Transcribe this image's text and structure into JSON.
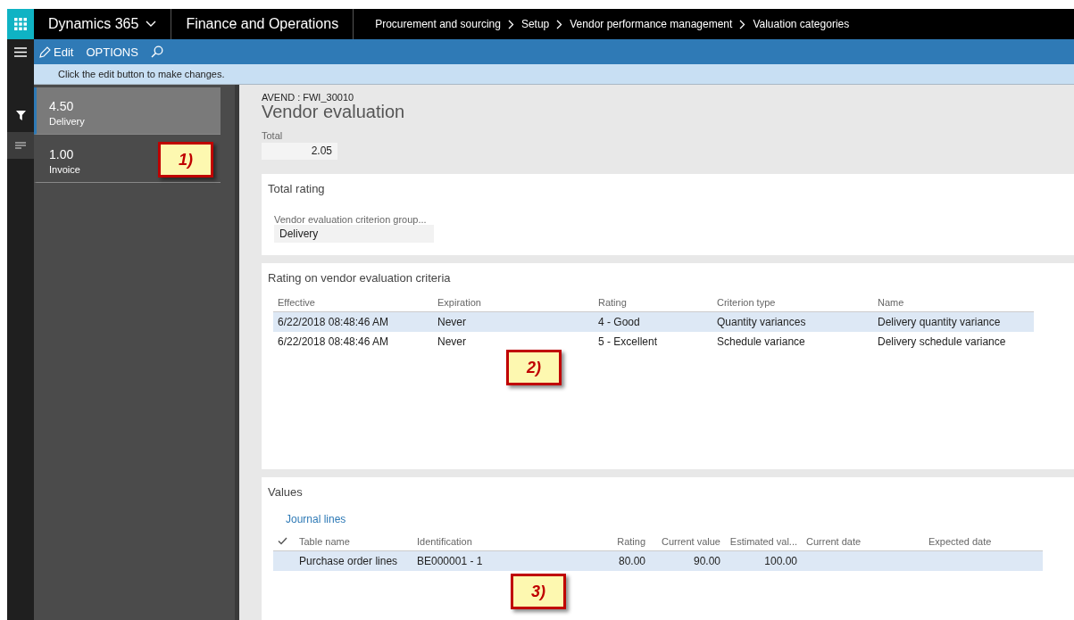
{
  "top_bar": {
    "product": "Dynamics 365",
    "app": "Finance and Operations",
    "breadcrumb": [
      "Procurement and sourcing",
      "Setup",
      "Vendor performance management",
      "Valuation categories"
    ]
  },
  "action_bar": {
    "edit": "Edit",
    "options": "OPTIONS"
  },
  "message": "Click the edit button to make changes.",
  "side_rail": [
    {
      "kind": "filter",
      "selected": false
    },
    {
      "kind": "list",
      "selected": true
    }
  ],
  "list": [
    {
      "value": "4.50",
      "label": "Delivery",
      "selected": true
    },
    {
      "value": "1.00",
      "label": "Invoice",
      "selected": false
    }
  ],
  "header": {
    "caption": "AVEND : FWI_30010",
    "title": "Vendor evaluation",
    "total_label": "Total",
    "total_value": "2.05"
  },
  "total_rating": {
    "title": "Total rating",
    "field_label": "Vendor evaluation criterion group...",
    "field_value": "Delivery"
  },
  "criteria": {
    "title": "Rating on vendor evaluation criteria",
    "columns": [
      "Effective",
      "Expiration",
      "Rating",
      "Criterion type",
      "Name"
    ],
    "rows": [
      {
        "cells": [
          "6/22/2018 08:48:46 AM",
          "Never",
          "4 - Good",
          "Quantity variances",
          "Delivery quantity variance"
        ],
        "selected": true
      },
      {
        "cells": [
          "6/22/2018 08:48:46 AM",
          "Never",
          "5 - Excellent",
          "Schedule variance",
          "Delivery schedule variance"
        ],
        "selected": false
      }
    ]
  },
  "values": {
    "title": "Values",
    "link": "Journal lines",
    "columns": [
      "Table name",
      "Identification",
      "Rating",
      "Current value",
      "Estimated val...",
      "Current date",
      "Expected date"
    ],
    "rows": [
      {
        "cells": [
          "Purchase order lines",
          "BE000001 - 1",
          "80.00",
          "90.00",
          "100.00",
          "",
          ""
        ],
        "selected": true
      }
    ]
  },
  "callouts": [
    "1)",
    "2)",
    "3)"
  ]
}
